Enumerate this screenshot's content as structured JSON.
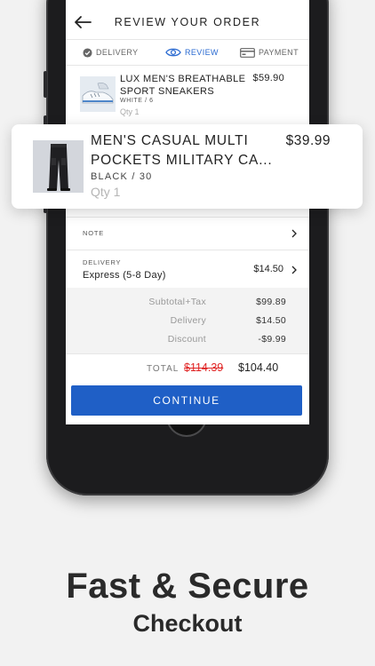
{
  "header": {
    "title": "REVIEW YOUR ORDER"
  },
  "steps": [
    {
      "label": "DELIVERY",
      "icon": "check-circle-icon",
      "state": "done"
    },
    {
      "label": "REVIEW",
      "icon": "eye-icon",
      "state": "active"
    },
    {
      "label": "PAYMENT",
      "icon": "credit-card-icon",
      "state": "pending"
    }
  ],
  "items": [
    {
      "name": "LUX MEN'S BREATHABLE SPORT SNEAKERS",
      "price": "$59.90",
      "variant": "WHITE / 6",
      "qty": "Qty 1"
    },
    {
      "name": "MEN'S CASUAL MULTI POCKETS MILITARY CA...",
      "price": "$39.99",
      "variant": "BLACK / 30",
      "qty": "Qty 1"
    }
  ],
  "note": {
    "label": "NOTE"
  },
  "delivery": {
    "label": "DELIVERY",
    "method": "Express (5-8 Day)",
    "amount": "$14.50"
  },
  "summary": [
    {
      "label": "Subtotal+Tax",
      "value": "$99.89"
    },
    {
      "label": "Delivery",
      "value": "$14.50"
    },
    {
      "label": "Discount",
      "value": "-$9.99"
    }
  ],
  "total": {
    "label": "TOTAL",
    "original": "$114.39",
    "final": "$104.40"
  },
  "continue_label": "CONTINUE",
  "headline": "Fast & Secure",
  "subline": "Checkout",
  "colors": {
    "accent": "#1f5fc6",
    "strike": "#e02424",
    "active_step": "#2a6ad1"
  }
}
